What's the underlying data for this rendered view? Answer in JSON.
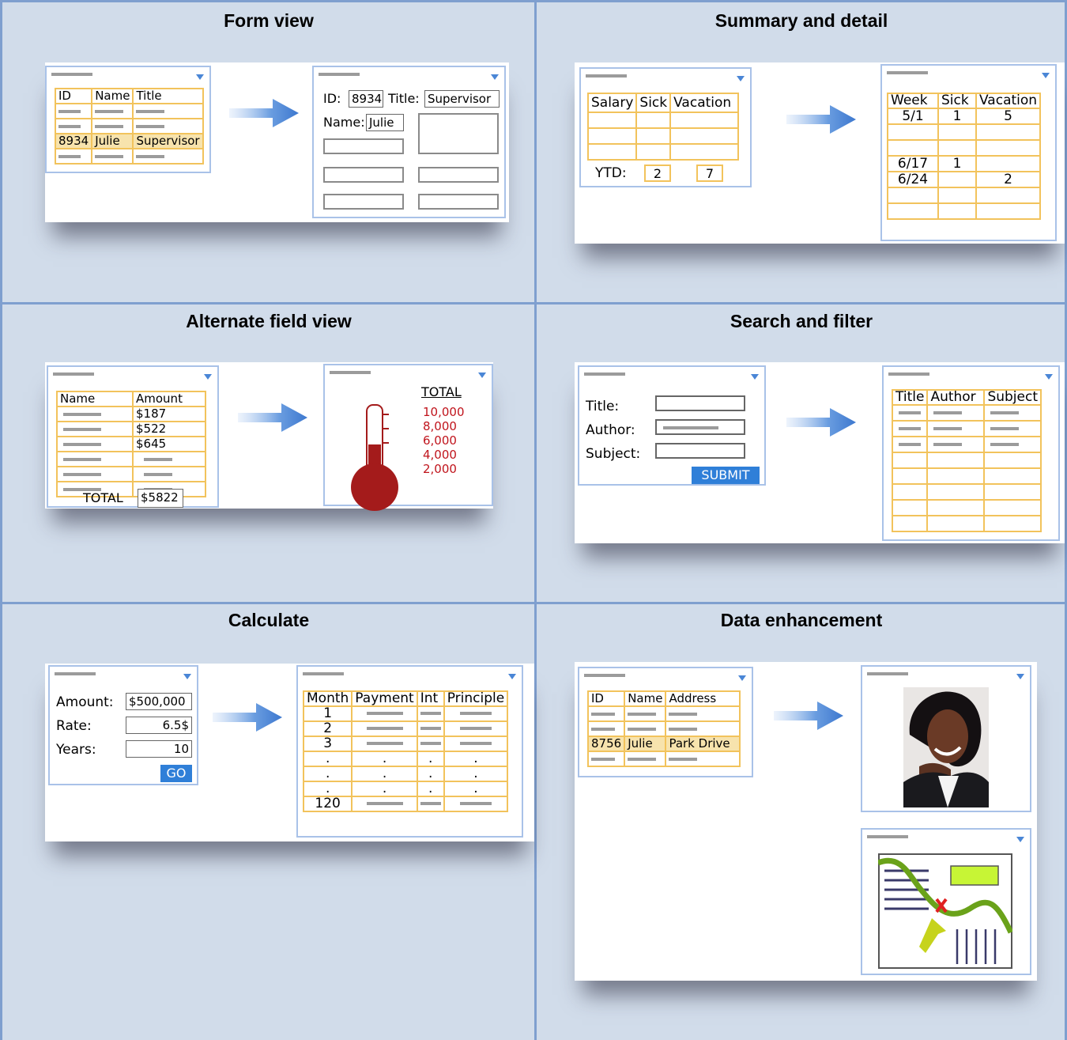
{
  "colors": {
    "panel_bg": "#d1dcea",
    "grid_line": "#7f9fcf",
    "table_border": "#f2c35c",
    "highlight_row": "#f7e3ad",
    "button": "#2f7fd8",
    "arrow": "#4a86d6",
    "thermo": "#a41b1b",
    "scale_text": "#c0141c"
  },
  "panels": {
    "form_view": {
      "title": "Form view",
      "list_headers": [
        "ID",
        "Name",
        "Title"
      ],
      "highlight_row": [
        "8934",
        "Julie",
        "Supervisor"
      ],
      "form": {
        "id_label": "ID:",
        "id_value": "8934",
        "title_label": "Title:",
        "title_value": "Supervisor",
        "name_label": "Name:",
        "name_value": "Julie"
      }
    },
    "summary_detail": {
      "title": "Summary and detail",
      "summary_headers": [
        "Salary",
        "Sick",
        "Vacation"
      ],
      "ytd_label": "YTD:",
      "ytd_sick": "2",
      "ytd_vacation": "7",
      "detail_headers": [
        "Week",
        "Sick",
        "Vacation"
      ],
      "detail_rows": [
        [
          "5/1",
          "1",
          "5"
        ],
        [
          "",
          "",
          ""
        ],
        [
          "",
          "",
          ""
        ],
        [
          "6/17",
          "1",
          ""
        ],
        [
          "6/24",
          "",
          "2"
        ],
        [
          "",
          "",
          ""
        ],
        [
          "",
          "",
          ""
        ]
      ]
    },
    "alternate_field": {
      "title": "Alternate field view",
      "headers": [
        "Name",
        "Amount"
      ],
      "amounts": [
        "$187",
        "$522",
        "$645"
      ],
      "total_label": "TOTAL",
      "total_value": "$5822",
      "scale_title": "TOTAL",
      "scale": [
        "10,000",
        "8,000",
        "6,000",
        "4,000",
        "2,000"
      ]
    },
    "search_filter": {
      "title": "Search and filter",
      "labels": [
        "Title:",
        "Author:",
        "Subject:"
      ],
      "submit": "SUBMIT",
      "result_headers": [
        "Title",
        "Author",
        "Subject"
      ]
    },
    "calculate": {
      "title": "Calculate",
      "amount_label": "Amount:",
      "amount_value": "$500,000",
      "rate_label": "Rate:",
      "rate_value": "6.5$",
      "years_label": "Years:",
      "years_value": "10",
      "go": "GO",
      "headers": [
        "Month",
        "Payment",
        "Int",
        "Principle"
      ],
      "months": [
        "1",
        "2",
        "3",
        ".",
        ".",
        ".",
        "120"
      ]
    },
    "data_enhancement": {
      "title": "Data enhancement",
      "headers": [
        "ID",
        "Name",
        "Address"
      ],
      "highlight_row": [
        "8756",
        "Julie",
        "Park Drive"
      ]
    }
  }
}
